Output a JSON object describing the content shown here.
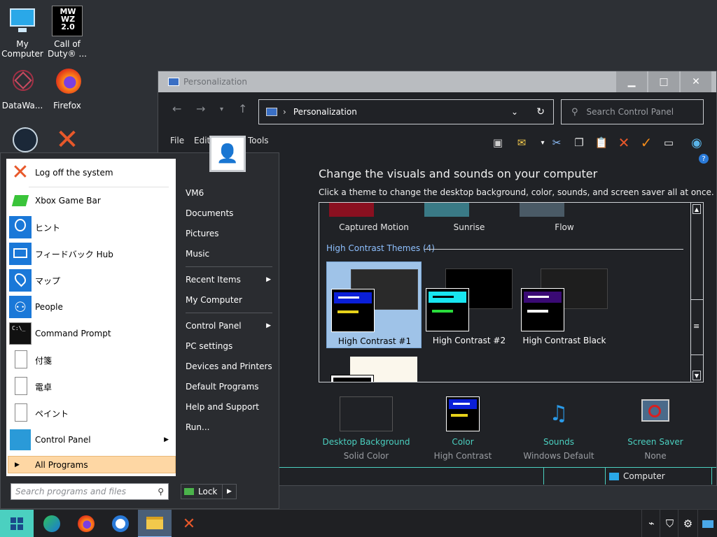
{
  "desktop": {
    "icons": [
      {
        "label": "My Computer",
        "icon": "monitor-icon"
      },
      {
        "label": "Call of Duty® ...",
        "icon": "call-of-duty-icon",
        "logo_text": "MW WZ 2.0"
      },
      {
        "label": "DataWa...",
        "icon": "datawave-icon"
      },
      {
        "label": "Firefox",
        "icon": "firefox-icon"
      },
      {
        "label": "",
        "icon": "steam-icon"
      },
      {
        "label": "",
        "icon": "x-icon"
      }
    ]
  },
  "window": {
    "title": "Personalization",
    "address": "Personalization",
    "search_placeholder": "Search Control Panel",
    "menu": [
      "File",
      "Edit",
      "Tools"
    ],
    "heading": "Change the visuals and sounds on your computer",
    "subheading": "Click a theme to change the desktop background, color, sounds, and screen saver all at once.",
    "top_themes": [
      "Captured Motion",
      "Sunrise",
      "Flow"
    ],
    "hc_group_label": "High Contrast Themes (4)",
    "hc_themes": [
      {
        "label": "High Contrast #1",
        "selected": true,
        "bar_color": "#0a1fd8",
        "accent": "#e6d21a",
        "bg": "#2a2a2a"
      },
      {
        "label": "High Contrast #2",
        "selected": false,
        "bar_color": "#18e6f0",
        "accent": "#2adc3c",
        "bg": "#000000"
      },
      {
        "label": "High Contrast Black",
        "selected": false,
        "bar_color": "#3a0a74",
        "accent": "#ffffff",
        "bg": "#1e1e1e"
      }
    ],
    "bottom": [
      {
        "label": "Desktop Background",
        "value": "Solid Color",
        "icon": "desktop-background-icon"
      },
      {
        "label": "Color",
        "value": "High Contrast",
        "icon": "color-icon"
      },
      {
        "label": "Sounds",
        "value": "Windows Default",
        "icon": "sounds-icon"
      },
      {
        "label": "Screen Saver",
        "value": "None",
        "icon": "screen-saver-icon"
      }
    ],
    "status_location": "Computer"
  },
  "start_menu": {
    "left_items": [
      {
        "label": "Log off the system",
        "icon": "log-off-icon"
      },
      {
        "label": "Xbox Game Bar",
        "icon": "xbox-game-bar-icon"
      },
      {
        "label": "ヒント",
        "icon": "tips-icon"
      },
      {
        "label": "フィードバック Hub",
        "icon": "feedback-hub-icon"
      },
      {
        "label": "マップ",
        "icon": "maps-icon"
      },
      {
        "label": "People",
        "icon": "people-icon"
      },
      {
        "label": "Command Prompt",
        "icon": "command-prompt-icon"
      },
      {
        "label": "付箋",
        "icon": "document-icon"
      },
      {
        "label": "電卓",
        "icon": "document-icon"
      },
      {
        "label": "ペイント",
        "icon": "document-icon"
      },
      {
        "label": "Control Panel",
        "icon": "control-panel-icon"
      }
    ],
    "all_programs": "All Programs",
    "search_placeholder": "Search programs and files",
    "right_items": [
      {
        "label": "VM6",
        "submenu": false
      },
      {
        "label": "Documents",
        "submenu": false
      },
      {
        "label": "Pictures",
        "submenu": false
      },
      {
        "label": "Music",
        "submenu": false
      },
      {
        "label": "Recent Items",
        "submenu": true
      },
      {
        "label": "My Computer",
        "submenu": false
      },
      {
        "label": "Control Panel",
        "submenu": true
      },
      {
        "label": "PC settings",
        "submenu": false
      },
      {
        "label": "Devices and Printers",
        "submenu": false
      },
      {
        "label": "Default Programs",
        "submenu": false
      },
      {
        "label": "Help and Support",
        "submenu": false
      },
      {
        "label": "Run...",
        "submenu": false
      }
    ],
    "lock_label": "Lock"
  },
  "taskbar": {
    "pinned": [
      "start-icon",
      "edge-icon",
      "firefox-icon",
      "chrome-icon",
      "file-explorer-icon",
      "x-icon"
    ],
    "tray": [
      "network-icon",
      "security-icon",
      "settings-icon",
      "notification-icon"
    ]
  },
  "colors": {
    "accent_teal": "#4bd0c0",
    "link_blue": "#8ec0ff",
    "selection": "#9fc3e8",
    "all_programs": "#fed7a4"
  }
}
